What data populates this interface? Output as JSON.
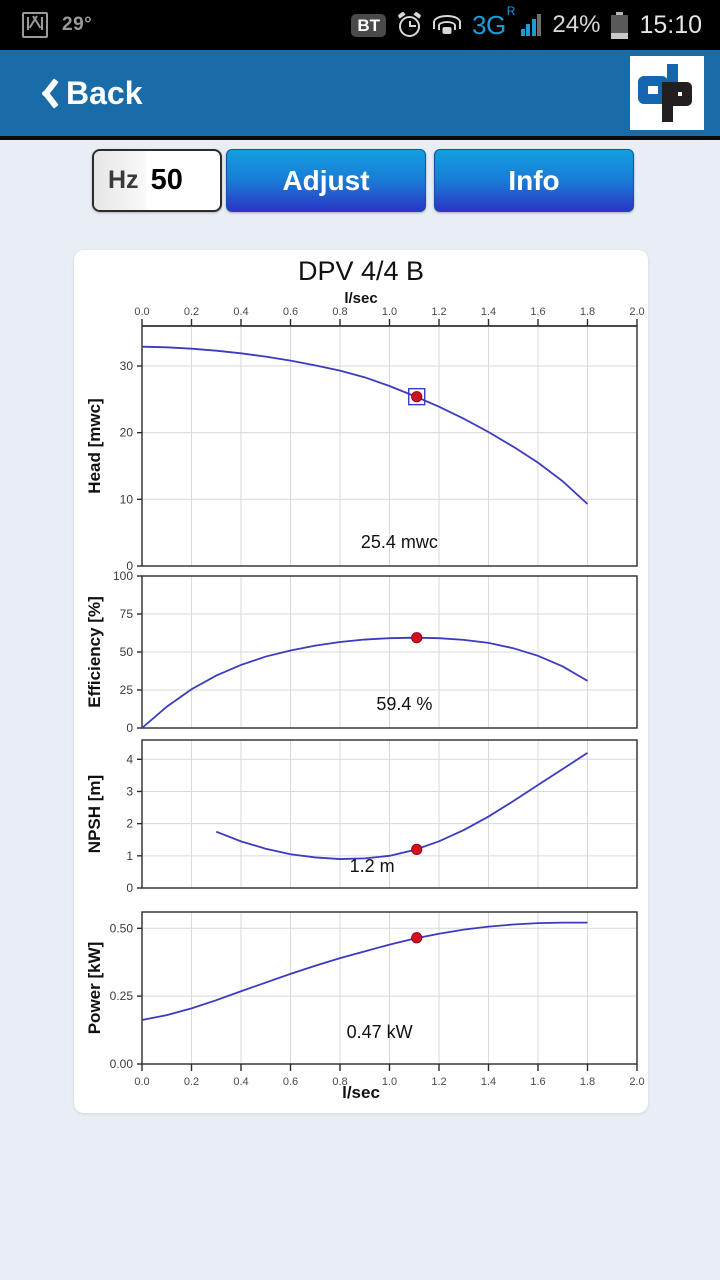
{
  "statusbar": {
    "temperature": "29°",
    "bt_label": "BT",
    "network": "3G",
    "network_sup": "R",
    "battery_percent": "24%",
    "clock": "15:10",
    "icons": {
      "mail": "gmail-icon",
      "alarm": "alarm-clock-icon",
      "wifi": "wifi-icon",
      "signal": "signal-bars-icon",
      "battery": "battery-icon"
    },
    "battery_fill_ratio": 0.24,
    "signal_bars_active": 3,
    "signal_bars_total": 4
  },
  "appbar": {
    "back_label": "Back",
    "back_icon": "chevron-left-icon",
    "logo_alt": "dp-logo",
    "bg_color": "#1a6ca8"
  },
  "toolbar": {
    "hz_label": "Hz",
    "hz_value": "50",
    "adjust_label": "Adjust",
    "info_label": "Info",
    "button_accent": "#1a79d6"
  },
  "chart_card": {
    "title": "DPV 4/4 B",
    "top_axis_label": "l/sec",
    "bottom_axis_label": "l/sec"
  },
  "chart_data": [
    {
      "type": "line",
      "title": "Head",
      "ylabel": "Head [mwc]",
      "xlabel": "l/sec",
      "xlim": [
        0.0,
        2.0
      ],
      "ylim": [
        0,
        36
      ],
      "xticks": [
        "0.0",
        "0.2",
        "0.4",
        "0.6",
        "0.8",
        "1.0",
        "1.2",
        "1.4",
        "1.6",
        "1.8",
        "2.0"
      ],
      "yticks": [
        "0",
        "10",
        "20",
        "30"
      ],
      "ytick_values": [
        0,
        10,
        20,
        30
      ],
      "grid": true,
      "annotation": "25.4 mwc",
      "marker": {
        "x": 1.11,
        "y": 25.4,
        "boxed": true
      },
      "x": [
        0.0,
        0.1,
        0.2,
        0.3,
        0.4,
        0.5,
        0.6,
        0.7,
        0.8,
        0.9,
        1.0,
        1.1,
        1.2,
        1.3,
        1.4,
        1.5,
        1.6,
        1.7,
        1.8
      ],
      "values": [
        32.9,
        32.8,
        32.6,
        32.3,
        31.9,
        31.4,
        30.8,
        30.1,
        29.3,
        28.3,
        27.0,
        25.5,
        23.9,
        22.1,
        20.1,
        17.9,
        15.5,
        12.7,
        9.3
      ]
    },
    {
      "type": "line",
      "title": "Efficiency",
      "ylabel": "Efficiency [%]",
      "xlabel": "l/sec",
      "xlim": [
        0.0,
        2.0
      ],
      "ylim": [
        0,
        100
      ],
      "yticks": [
        "0",
        "25",
        "50",
        "75",
        "100"
      ],
      "ytick_values": [
        0,
        25,
        50,
        75,
        100
      ],
      "grid": true,
      "annotation": "59.4 %",
      "marker": {
        "x": 1.11,
        "y": 59.4,
        "boxed": false
      },
      "x": [
        0.0,
        0.1,
        0.2,
        0.3,
        0.4,
        0.5,
        0.6,
        0.7,
        0.8,
        0.9,
        1.0,
        1.1,
        1.2,
        1.3,
        1.4,
        1.5,
        1.6,
        1.7,
        1.8
      ],
      "values": [
        0.0,
        14.0,
        25.5,
        34.5,
        41.5,
        47.0,
        51.0,
        54.2,
        56.6,
        58.2,
        59.1,
        59.4,
        59.1,
        58.0,
        56.0,
        52.5,
        47.5,
        40.5,
        31.0
      ]
    },
    {
      "type": "line",
      "title": "NPSH",
      "ylabel": "NPSH [m]",
      "xlabel": "l/sec",
      "xlim": [
        0.0,
        2.0
      ],
      "ylim": [
        0,
        4.6
      ],
      "yticks": [
        "0",
        "1",
        "2",
        "3",
        "4"
      ],
      "ytick_values": [
        0,
        1,
        2,
        3,
        4
      ],
      "grid": true,
      "annotation": "1.2 m",
      "marker": {
        "x": 1.11,
        "y": 1.2,
        "boxed": false
      },
      "x": [
        0.3,
        0.4,
        0.5,
        0.6,
        0.7,
        0.8,
        0.9,
        1.0,
        1.1,
        1.2,
        1.3,
        1.4,
        1.5,
        1.6,
        1.7,
        1.8
      ],
      "values": [
        1.75,
        1.45,
        1.22,
        1.05,
        0.95,
        0.9,
        0.92,
        1.0,
        1.18,
        1.45,
        1.8,
        2.22,
        2.7,
        3.2,
        3.7,
        4.2
      ]
    },
    {
      "type": "line",
      "title": "Power",
      "ylabel": "Power [kW]",
      "xlabel": "l/sec",
      "xlim": [
        0.0,
        2.0
      ],
      "ylim": [
        0.0,
        0.56
      ],
      "yticks": [
        "0.00",
        "0.25",
        "0.50"
      ],
      "ytick_values": [
        0.0,
        0.25,
        0.5
      ],
      "grid": true,
      "annotation": "0.47 kW",
      "marker": {
        "x": 1.11,
        "y": 0.465,
        "boxed": false
      },
      "x": [
        0.0,
        0.1,
        0.2,
        0.3,
        0.4,
        0.5,
        0.6,
        0.7,
        0.8,
        0.9,
        1.0,
        1.1,
        1.2,
        1.3,
        1.4,
        1.5,
        1.6,
        1.7,
        1.8
      ],
      "values": [
        0.162,
        0.18,
        0.205,
        0.235,
        0.268,
        0.3,
        0.332,
        0.362,
        0.39,
        0.415,
        0.44,
        0.462,
        0.48,
        0.495,
        0.506,
        0.514,
        0.519,
        0.521,
        0.521
      ]
    }
  ]
}
